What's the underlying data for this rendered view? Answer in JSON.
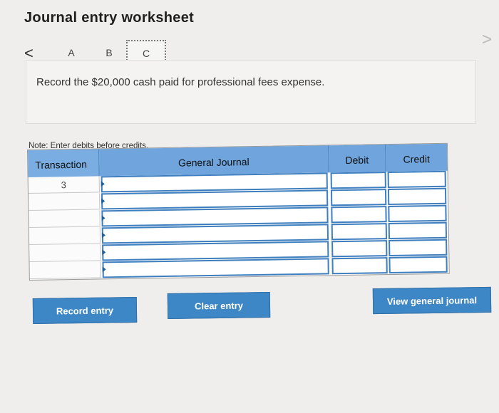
{
  "worksheet": {
    "title": "Journal entry worksheet",
    "nav_prev": "<",
    "nav_next": ">",
    "tabs": [
      "A",
      "B",
      "C"
    ],
    "active_tab": "C",
    "prompt": "Record the $20,000 cash paid for professional fees expense.",
    "note": "Note: Enter debits before credits."
  },
  "journal": {
    "headers": {
      "transaction": "Transaction",
      "general_journal": "General Journal",
      "debit": "Debit",
      "credit": "Credit"
    },
    "rows": [
      {
        "transaction": "3",
        "general_journal": "",
        "debit": "",
        "credit": ""
      },
      {
        "transaction": "",
        "general_journal": "",
        "debit": "",
        "credit": ""
      },
      {
        "transaction": "",
        "general_journal": "",
        "debit": "",
        "credit": ""
      },
      {
        "transaction": "",
        "general_journal": "",
        "debit": "",
        "credit": ""
      },
      {
        "transaction": "",
        "general_journal": "",
        "debit": "",
        "credit": ""
      },
      {
        "transaction": "",
        "general_journal": "",
        "debit": "",
        "credit": ""
      }
    ]
  },
  "buttons": {
    "record": "Record entry",
    "clear": "Clear entry",
    "view": "View general journal"
  },
  "colors": {
    "header_blue": "#6fa5dc",
    "button_blue": "#3e87c6",
    "input_border": "#3f7fbf"
  }
}
